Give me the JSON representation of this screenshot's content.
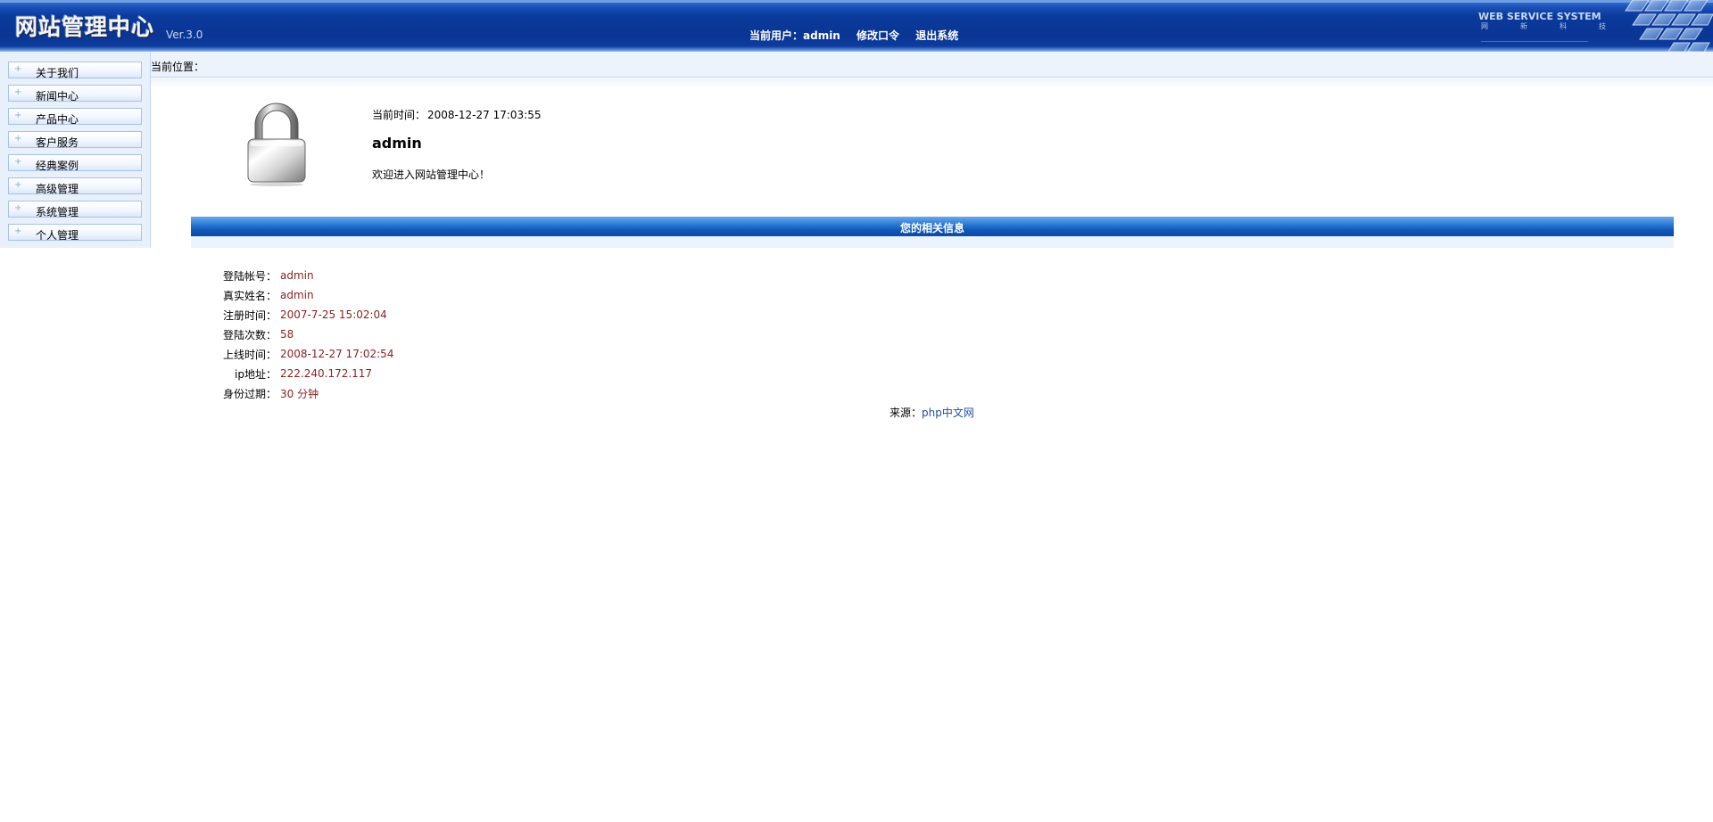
{
  "header": {
    "logo": "网站管理中心",
    "version": "Ver.3.0",
    "current_user_label": "当前用户：admin",
    "change_password": "修改口令",
    "logout": "退出系统",
    "brand_en": "WEB SERVICE SYSTEM",
    "brand_cn": [
      "网",
      "新",
      "科",
      "技"
    ]
  },
  "sidebar": {
    "items": [
      {
        "label": "关于我们"
      },
      {
        "label": "新闻中心"
      },
      {
        "label": "产品中心"
      },
      {
        "label": "客户服务"
      },
      {
        "label": "经典案例"
      },
      {
        "label": "高级管理"
      },
      {
        "label": "系统管理"
      },
      {
        "label": "个人管理"
      }
    ],
    "icon": "+"
  },
  "breadcrumb": {
    "label": "当前位置："
  },
  "welcome": {
    "time_label": "当前时间：",
    "time_value": "2008-12-27 17:03:55",
    "username": "admin",
    "message": "欢迎进入网站管理中心！"
  },
  "info": {
    "title": "您的相关信息",
    "rows": [
      {
        "key": "登陆帐号：",
        "value": "admin"
      },
      {
        "key": "真实姓名：",
        "value": "admin"
      },
      {
        "key": "注册时间：",
        "value": "2007-7-25 15:02:04"
      },
      {
        "key": "登陆次数：",
        "value": "58"
      },
      {
        "key": "上线时间：",
        "value": "2008-12-27 17:02:54"
      },
      {
        "key": "ip地址：",
        "value": "222.240.172.117"
      },
      {
        "key": "身份过期：",
        "value": "30 分钟"
      }
    ]
  },
  "source": {
    "label": "来源：",
    "link": "php中文网"
  },
  "colors": {
    "header_blue": "#0a3594",
    "info_value": "#8a1f1f",
    "link": "#1e4f9c"
  }
}
